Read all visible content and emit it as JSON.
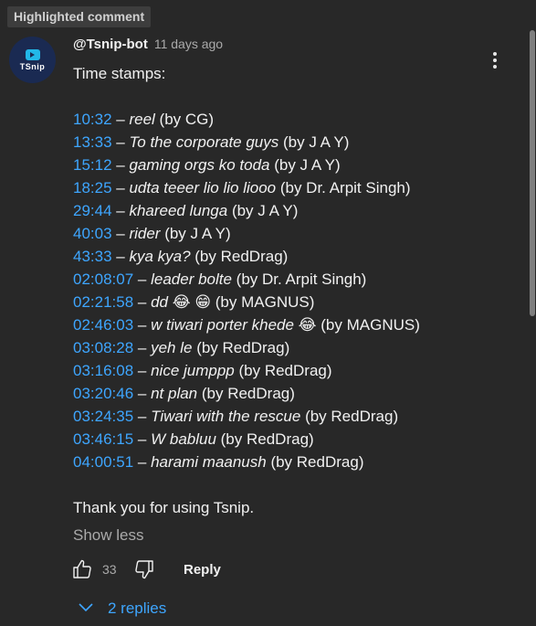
{
  "badge": "Highlighted comment",
  "avatar": {
    "logo_text": "TSnip"
  },
  "comment": {
    "author": "@Tsnip-bot",
    "time": "11 days ago",
    "intro": "Time stamps:",
    "entries": [
      {
        "time": "10:32",
        "title": "reel",
        "by": " (by CG)"
      },
      {
        "time": "13:33",
        "title": "To the corporate guys",
        "by": " (by J A Y)"
      },
      {
        "time": "15:12",
        "title": "gaming orgs ko toda",
        "by": " (by J A Y)"
      },
      {
        "time": "18:25",
        "title": "udta teeer lio lio liooo",
        "by": " (by Dr. Arpit Singh)"
      },
      {
        "time": "29:44",
        "title": "khareed lunga",
        "by": " (by J A Y)"
      },
      {
        "time": "40:03",
        "title": "rider",
        "by": " (by J A Y)"
      },
      {
        "time": "43:33",
        "title": "kya kya?",
        "by": " (by RedDrag)"
      },
      {
        "time": "02:08:07",
        "title": "leader bolte",
        "by": " (by Dr. Arpit Singh)"
      },
      {
        "time": "02:21:58",
        "title": "dd 😂 😁",
        "by": " (by MAGNUS)"
      },
      {
        "time": "02:46:03",
        "title": "w tiwari porter khede 😂",
        "by": " (by MAGNUS)"
      },
      {
        "time": "03:08:28",
        "title": "yeh le",
        "by": " (by RedDrag)"
      },
      {
        "time": "03:16:08",
        "title": "nice jumppp",
        "by": " (by RedDrag)"
      },
      {
        "time": "03:20:46",
        "title": "nt plan",
        "by": " (by RedDrag)"
      },
      {
        "time": "03:24:35",
        "title": "Tiwari with the rescue",
        "by": " (by RedDrag)"
      },
      {
        "time": "03:46:15",
        "title": "W babluu",
        "by": " (by RedDrag)"
      },
      {
        "time": "04:00:51",
        "title": "harami maanush",
        "by": " (by RedDrag)"
      }
    ],
    "separator": " – ",
    "ending": "Thank you for using Tsnip.",
    "show_less": "Show less"
  },
  "actions": {
    "like_count": "33",
    "reply_label": "Reply",
    "like_icon": "thumbs-up-icon",
    "dislike_icon": "thumbs-down-icon"
  },
  "replies": {
    "label": "2 replies",
    "icon": "chevron-down-icon"
  },
  "colors": {
    "background": "#282828",
    "link": "#3ea6ff",
    "muted": "#aaaaaa",
    "text": "#f1f1f1"
  }
}
